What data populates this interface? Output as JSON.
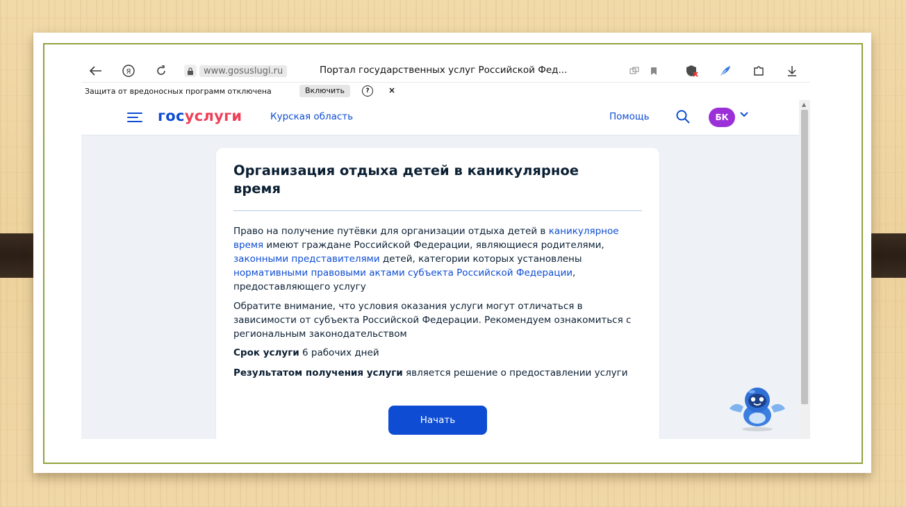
{
  "browser": {
    "url_domain": "www.gosuslugi.ru",
    "page_title": "Портал государственных услуг Российской Фед...",
    "notice": {
      "text": "Защита от вредоносных программ отключена",
      "enable_button": "Включить",
      "help_glyph": "?",
      "close_glyph": "×"
    }
  },
  "site": {
    "logo_part1": "гос",
    "logo_part2": "услуги",
    "region": "Курская область",
    "help": "Помощь",
    "avatar_initials": "БК"
  },
  "service": {
    "title": "Организация отдыха детей в каникулярное время",
    "p1": {
      "t1": "Право на получение путёвки для организации отдыха детей в ",
      "link1": "каникулярное время",
      "t2": " имеют граждане Российской Федерации, являющиеся родителями, ",
      "link2": "законными представителями",
      "t3": " детей, категории которых установлены ",
      "link3": "нормативными правовыми актами субъекта Российской Федерации",
      "t4": ", предоставляющего услугу"
    },
    "p2": "Обратите внимание, что условия оказания услуги могут отличаться в зависимости от субъекта Российской Федерации. Рекомендуем ознакомиться с региональным законодательством",
    "term_label": "Срок услуги",
    "term_value": " 6 рабочих дней",
    "result_label": "Результатом получения услуги",
    "result_value": " является решение о предоставлении услуги",
    "start_button": "Начать"
  },
  "colors": {
    "accent": "#0d4cd3",
    "logo_red": "#ee3f58",
    "avatar": "#9b30d9",
    "frame": "#8fa33c"
  }
}
